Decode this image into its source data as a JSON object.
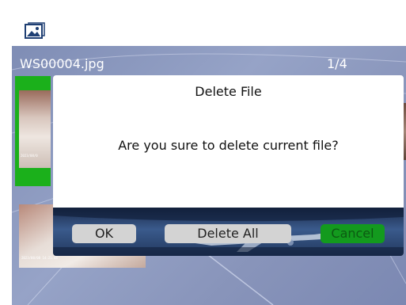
{
  "header": {
    "icon": "gallery-icon"
  },
  "viewer": {
    "filename": "WS00004.jpg",
    "counter": "1/4",
    "thumbnails": [
      {
        "timestamp": "2023/08/0",
        "selected": true
      },
      {
        "timestamp": "2023/08/08  14:21:44",
        "selected": false
      }
    ]
  },
  "dialog": {
    "title": "Delete File",
    "message": "Are you sure to delete current file?",
    "buttons": {
      "ok": "OK",
      "delete_all": "Delete All",
      "cancel": "Cancel"
    }
  },
  "colors": {
    "selected_border": "#1bb01b",
    "cancel_button": "#139a1e",
    "button_gray": "#d3d3d3"
  }
}
